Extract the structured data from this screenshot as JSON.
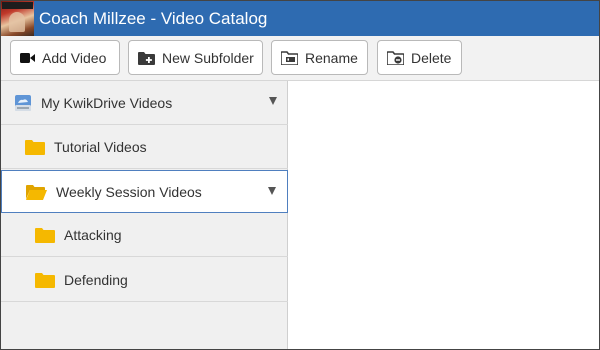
{
  "window": {
    "title": "Coach Millzee - Video Catalog"
  },
  "toolbar": {
    "add_video": "Add Video",
    "new_subfolder": "New Subfolder",
    "rename": "Rename",
    "delete": "Delete"
  },
  "tree": {
    "root": {
      "label": "My KwikDrive Videos",
      "icon": "drive-icon",
      "expanded": true
    },
    "items": [
      {
        "label": "Tutorial Videos",
        "icon": "folder-icon",
        "expanded": false
      },
      {
        "label": "Weekly Session Videos",
        "icon": "folder-open-icon",
        "expanded": true,
        "selected": true
      },
      {
        "label": "Attacking",
        "icon": "folder-icon",
        "expanded": false
      },
      {
        "label": "Defending",
        "icon": "folder-icon",
        "expanded": false
      }
    ]
  },
  "colors": {
    "titlebar": "#2e6bb1",
    "folder": "#f5b800",
    "selection_border": "#4f7fbf"
  }
}
